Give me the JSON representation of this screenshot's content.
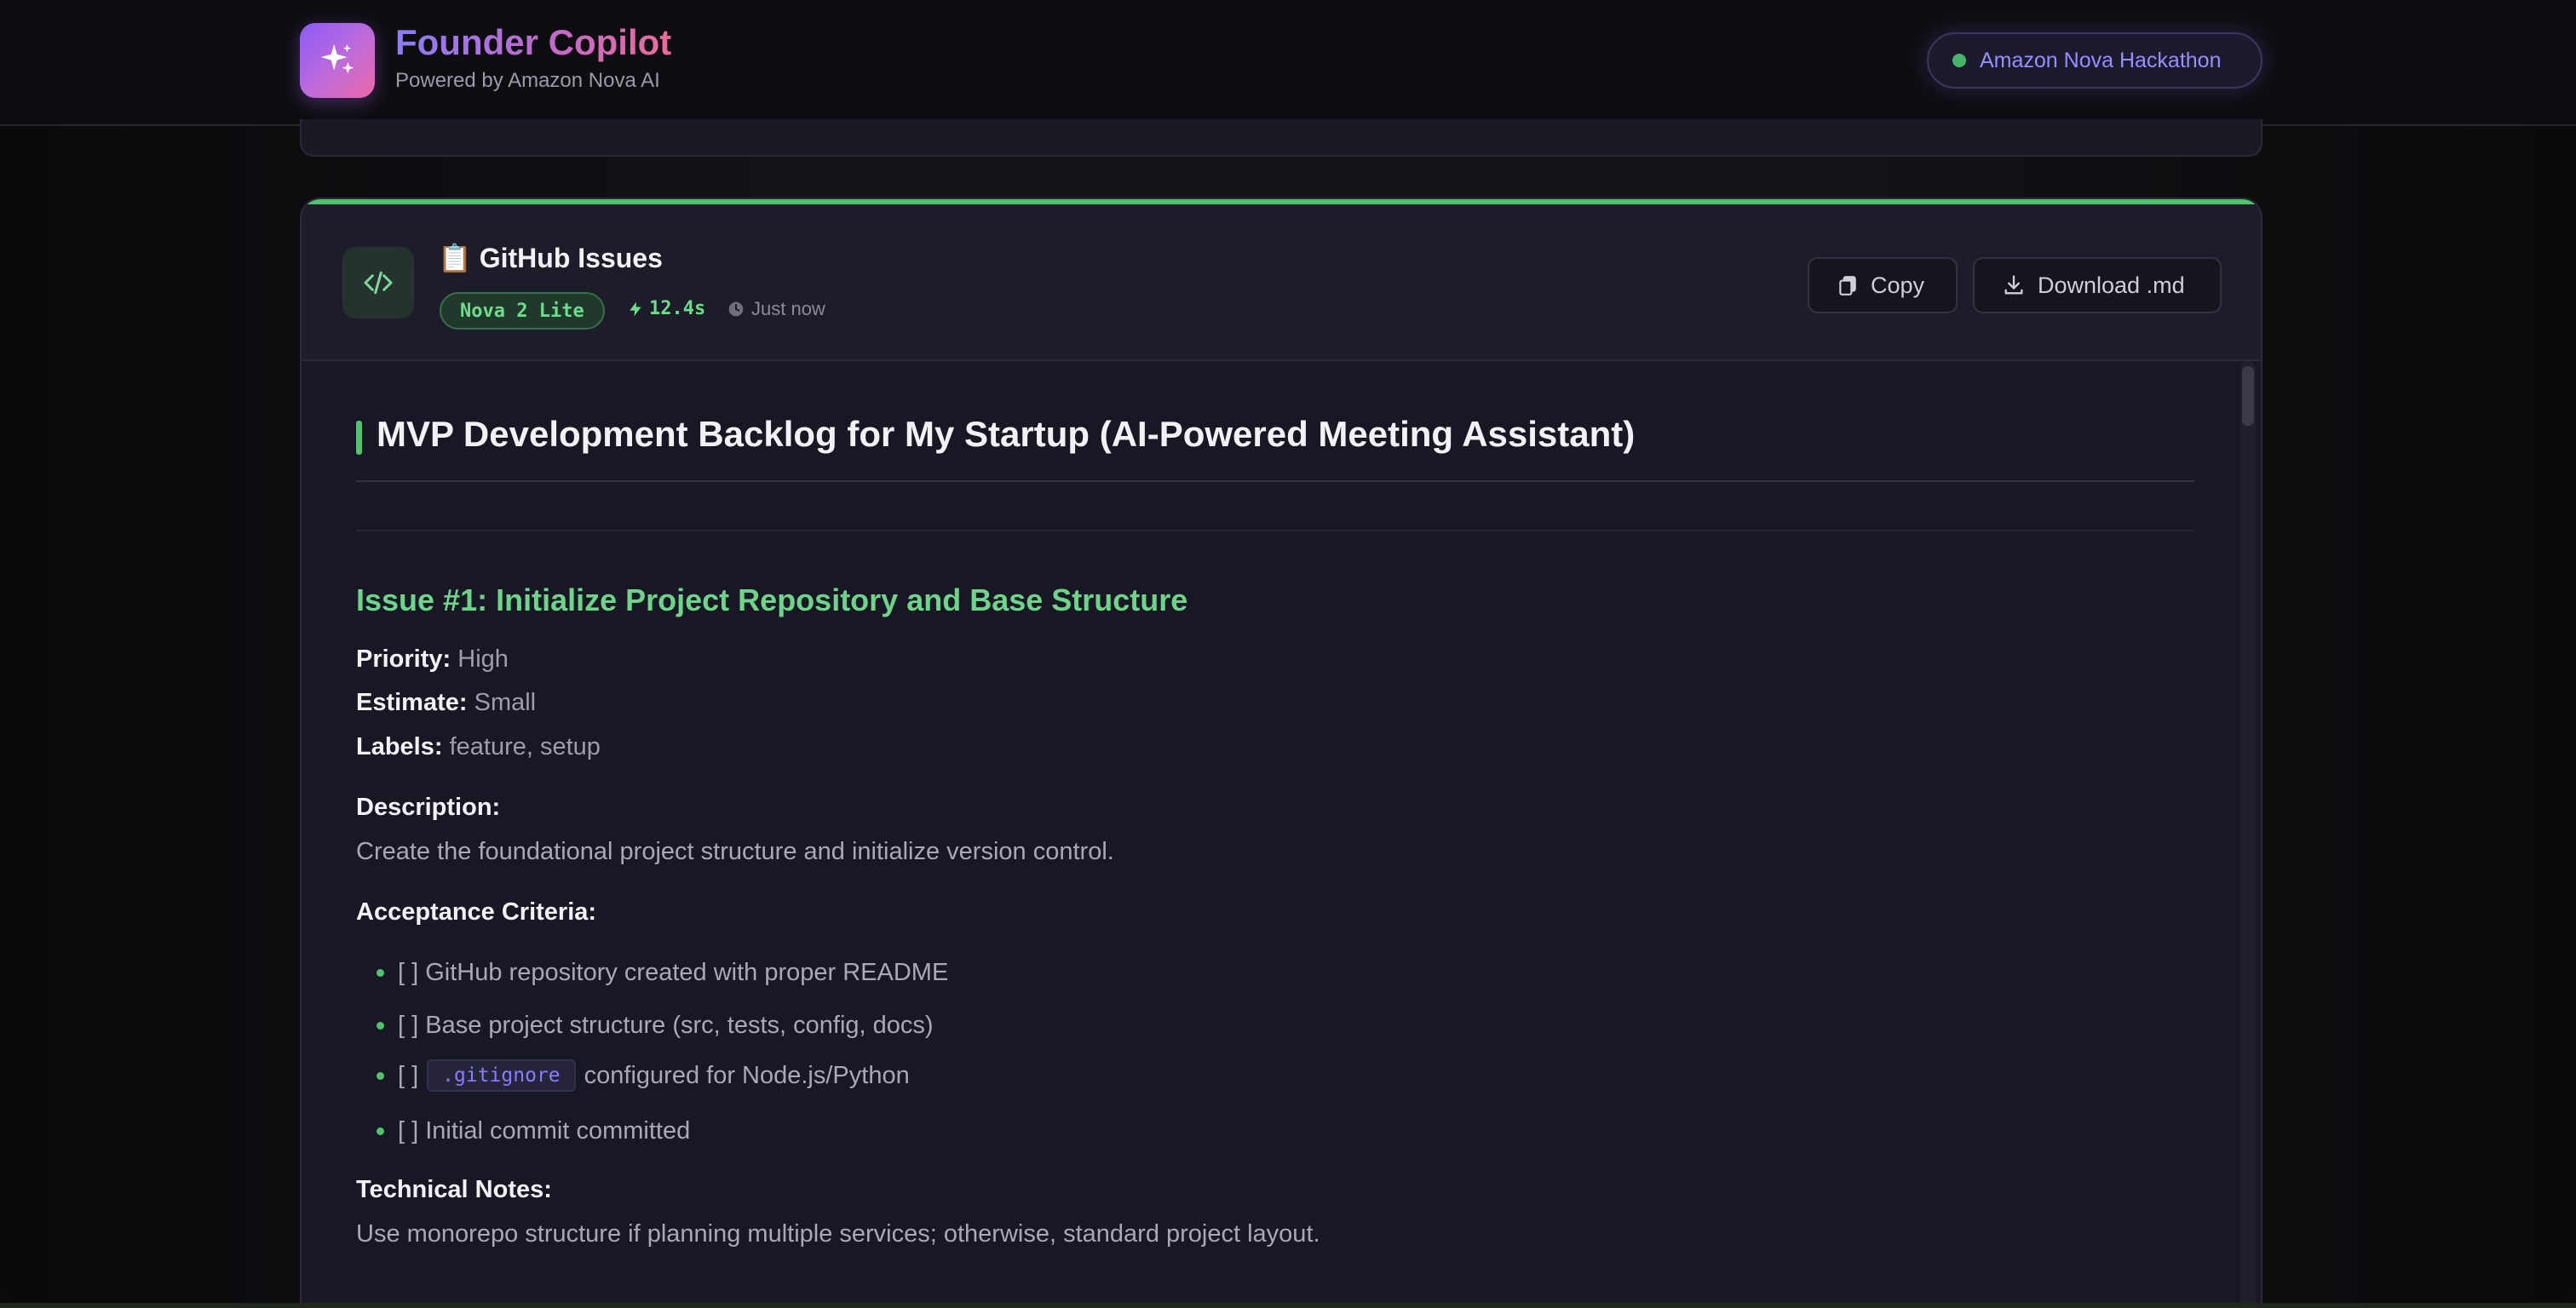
{
  "header": {
    "brand_title": "Founder Copilot",
    "brand_subtitle": "Powered by Amazon Nova AI",
    "badge_label": "Amazon Nova Hackathon"
  },
  "card": {
    "title": "📋 GitHub Issues",
    "model": "Nova 2 Lite",
    "duration": "12.4s",
    "timestamp": "Just now",
    "copy_label": "Copy",
    "download_label": "Download .md",
    "accent_color": "#4ec46e"
  },
  "content": {
    "heading": "MVP Development Backlog for My Startup (AI-Powered Meeting Assistant)",
    "issue_title": "Issue #1: Initialize Project Repository and Base Structure",
    "priority_label": "Priority:",
    "priority_value": "High",
    "estimate_label": "Estimate:",
    "estimate_value": "Small",
    "labels_label": "Labels:",
    "labels_value": "feature, setup",
    "description_label": "Description:",
    "description_text": "Create the foundational project structure and initialize version control.",
    "acceptance_label": "Acceptance Criteria:",
    "criteria": [
      "[ ] GitHub repository created with proper README",
      "[ ] Base project structure (src, tests, config, docs)",
      "[ ]",
      "[ ] Initial commit committed"
    ],
    "criteria_code": ".gitignore",
    "criteria_code_suffix": "configured for Node.js/Python",
    "tech_notes_label": "Technical Notes:",
    "tech_notes_text": "Use monorepo structure if planning multiple services; otherwise, standard project layout."
  }
}
